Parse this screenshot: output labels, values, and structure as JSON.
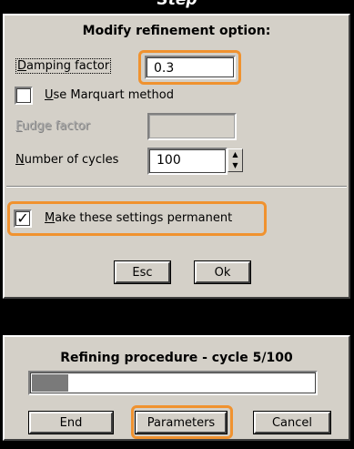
{
  "step_title": "Step",
  "dialog1": {
    "title": "Modify refinement option:",
    "damping": {
      "label": "Damping factor",
      "value": "0.3"
    },
    "marquart": {
      "label": "Use Marquart method",
      "checked": false
    },
    "fudge": {
      "label": "Fudge factor",
      "value": ""
    },
    "cycles": {
      "label": "Number of cycles",
      "value": "100"
    },
    "permanent": {
      "label": "Make these settings permanent",
      "checked": true,
      "mark": "✓"
    },
    "buttons": {
      "esc": "Esc",
      "ok": "Ok"
    }
  },
  "dialog2": {
    "title": "Refining procedure - cycle 5/100",
    "progress_fraction": 0.05,
    "buttons": {
      "end": "End",
      "parameters": "Parameters",
      "cancel": "Cancel"
    }
  },
  "colors": {
    "highlight": "#f0922f",
    "dialog_bg": "#d4d0c8",
    "background": "#000000"
  }
}
